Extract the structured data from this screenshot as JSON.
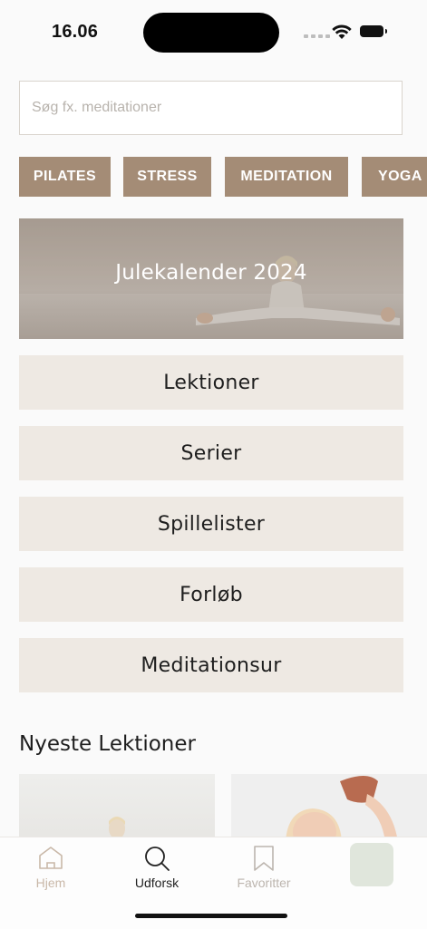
{
  "status_bar": {
    "time": "16.06"
  },
  "search": {
    "placeholder": "Søg fx. meditationer"
  },
  "chips": [
    {
      "label": "PILATES"
    },
    {
      "label": "STRESS"
    },
    {
      "label": "MEDITATION"
    },
    {
      "label": "YOGA"
    }
  ],
  "banner": {
    "title": "Julekalender 2024"
  },
  "categories": [
    {
      "label": "Lektioner"
    },
    {
      "label": "Serier"
    },
    {
      "label": "Spillelister"
    },
    {
      "label": "Forløb"
    },
    {
      "label": "Meditationsur"
    }
  ],
  "newest": {
    "title": "Nyeste Lektioner"
  },
  "tabbar": {
    "home": "Hjem",
    "explore": "Udforsk",
    "favorites": "Favoritter",
    "active_tab": "Udforsk"
  },
  "colors": {
    "chip_bg": "#a48c76",
    "category_bg": "#eee9e3",
    "home_tab": "#c9b8a8",
    "avatar_bg": "#e0e6dc"
  },
  "icons": {
    "home": "house-icon",
    "explore": "search-icon",
    "favorites": "bookmark-icon",
    "wifi": "wifi-icon",
    "battery": "battery-icon",
    "signal": "cellular-signal-icon"
  }
}
